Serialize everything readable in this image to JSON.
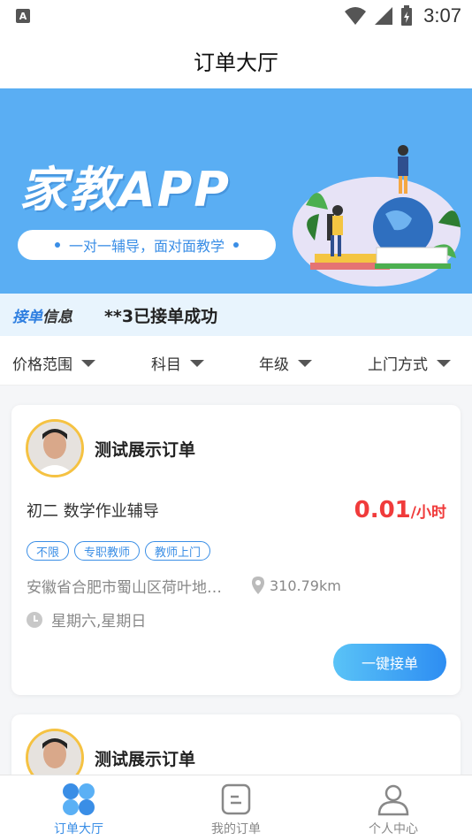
{
  "status_bar": {
    "time": "3:07",
    "left_icon": "A"
  },
  "header": {
    "title": "订单大厅"
  },
  "banner": {
    "title": "家教APP",
    "slogan": "一对一辅导，面对面教学"
  },
  "info_bar": {
    "label_part1": "接单",
    "label_part2": "信息",
    "message": "**3已接单成功"
  },
  "filters": [
    {
      "label": "价格范围"
    },
    {
      "label": "科目"
    },
    {
      "label": "年级"
    },
    {
      "label": "上门方式"
    }
  ],
  "orders": [
    {
      "title": "测试展示订单",
      "subject": "初二 数学作业辅导",
      "price": "0.01",
      "price_unit": "/小时",
      "tags": [
        "不限",
        "专职教师",
        "教师上门"
      ],
      "address": "安徽省合肥市蜀山区荷叶地街道",
      "distance": "310.79km",
      "days": "星期六,星期日",
      "button": "一键接单"
    },
    {
      "title": "测试展示订单"
    }
  ],
  "tabbar": [
    {
      "label": "订单大厅",
      "icon": "order-hall-icon",
      "active": true
    },
    {
      "label": "我的订单",
      "icon": "my-orders-icon",
      "active": false
    },
    {
      "label": "个人中心",
      "icon": "profile-icon",
      "active": false
    }
  ],
  "colors": {
    "accent": "#3a8ee6",
    "price": "#f03b3b",
    "banner_bg": "#5aaef3"
  }
}
